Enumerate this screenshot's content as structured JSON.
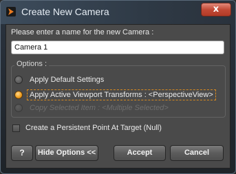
{
  "window": {
    "title": "Create New Camera",
    "close_label": "x"
  },
  "prompt": {
    "label": "Please enter a name for the new Camera :",
    "value": "Camera 1"
  },
  "options": {
    "group_label": "Options :",
    "items": [
      {
        "label": "Apply Default Settings",
        "checked": false,
        "enabled": true
      },
      {
        "label": "Apply Active Viewport Transforms : <PerspectiveView>",
        "checked": true,
        "enabled": true
      },
      {
        "label": "Copy Selected Item : <Multiple Selected>",
        "checked": false,
        "enabled": false
      }
    ]
  },
  "checkbox": {
    "label": "Create a Persistent Point At Target (Null)",
    "checked": false
  },
  "buttons": {
    "help": "?",
    "hide_options": "Hide Options <<",
    "accept": "Accept",
    "cancel": "Cancel"
  },
  "colors": {
    "accent": "#f0a020",
    "close": "#c24a36"
  },
  "icons": {
    "app": "daz-logo-icon",
    "help": "help-icon"
  }
}
